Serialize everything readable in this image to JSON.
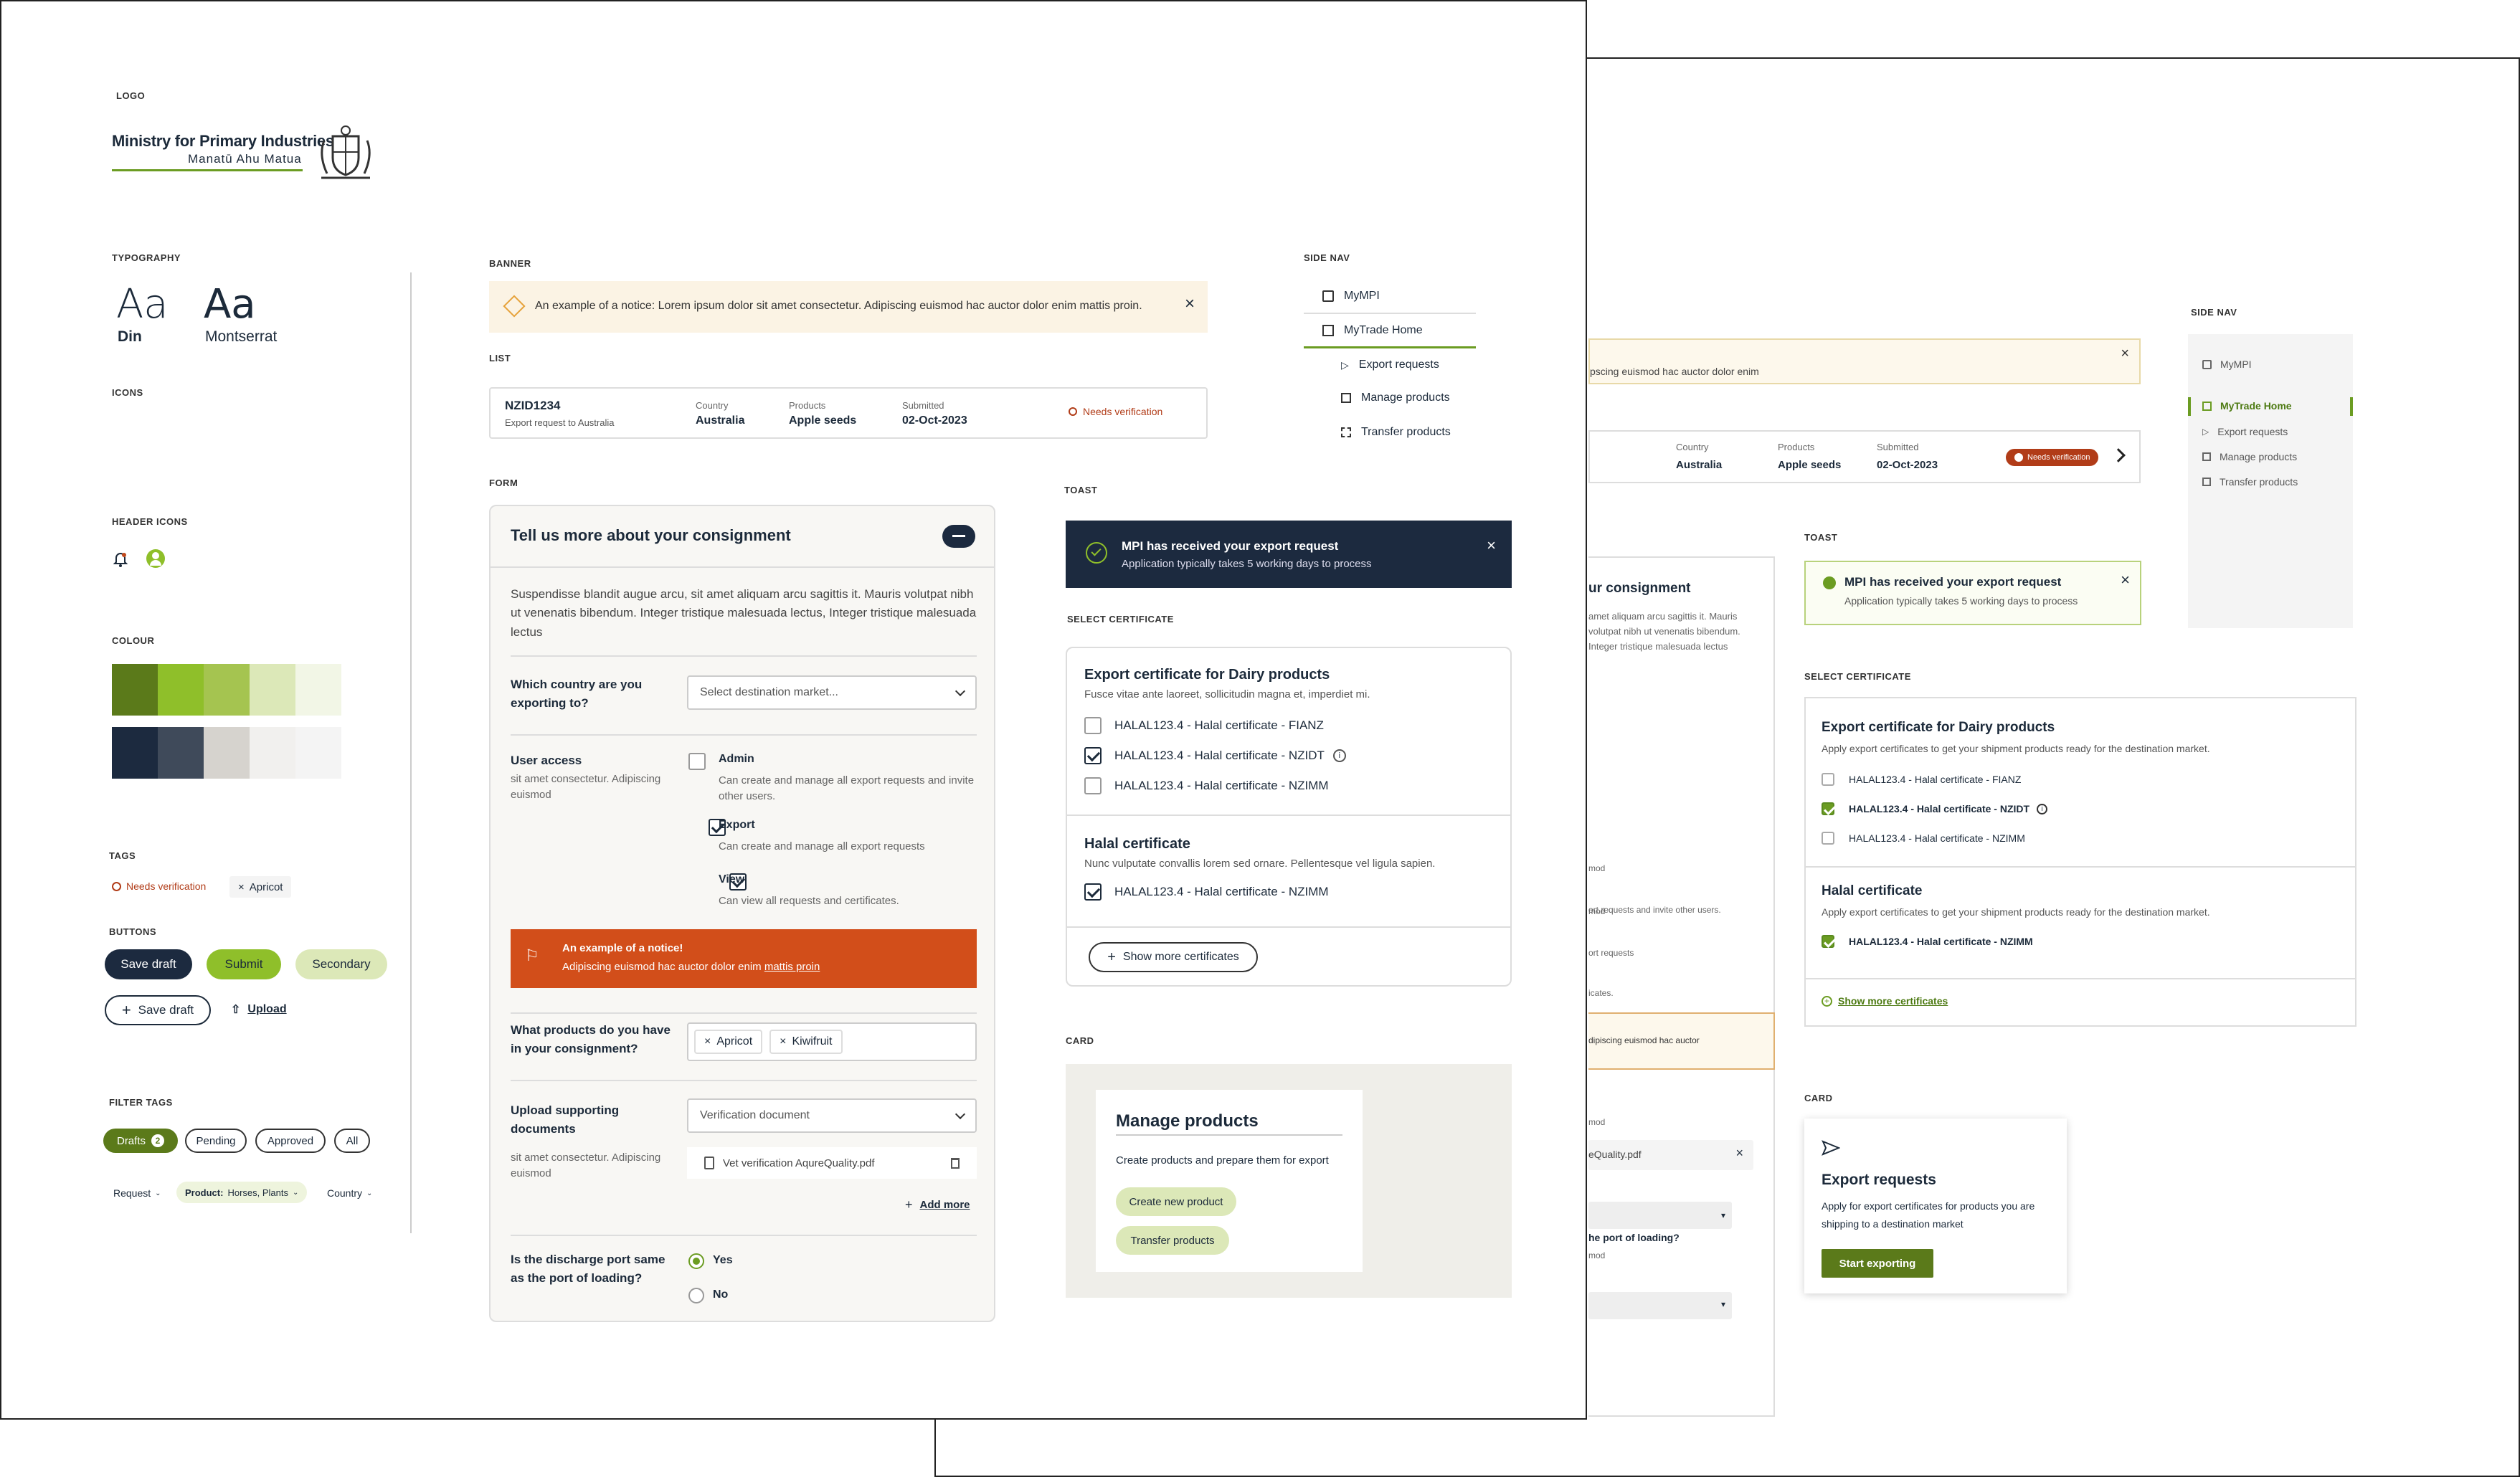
{
  "left": {
    "logo_label": "LOGO",
    "logo_title": "Ministry for Primary Industries",
    "logo_subtitle": "Manatū Ahu Matua",
    "typography_label": "TYPOGRAPHY",
    "type_sample": "Aa",
    "font_din": "Din",
    "font_montserrat": "Montserrat",
    "icons_label": "ICONS",
    "header_icons_label": "HEADER ICONS",
    "colour_label": "COLOUR",
    "colours_row1": [
      "#5b7a1a",
      "#8fbf2a",
      "#a5c450",
      "#dce8b8",
      "#f2f6e6"
    ],
    "colours_row2": [
      "#1c2a3f",
      "#3f4a5a",
      "#d6d3ce",
      "#f1f0ee",
      "#f4f4f4"
    ],
    "tags_label": "TAGS",
    "tag_needs": "Needs verification",
    "tag_apricot": "Apricot",
    "buttons_label": "BUTTONS",
    "btn_save_draft": "Save draft",
    "btn_submit": "Submit",
    "btn_secondary": "Secondary",
    "btn_save_draft_outline": "Save draft",
    "btn_upload": "Upload",
    "filter_label": "FILTER TAGS",
    "filter_drafts": "Drafts",
    "filter_drafts_count": "2",
    "filter_pending": "Pending",
    "filter_approved": "Approved",
    "filter_all": "All",
    "dd_request": "Request",
    "dd_product_key": "Product:",
    "dd_product_value": "Horses, Plants",
    "dd_country": "Country"
  },
  "banner": {
    "label": "BANNER",
    "text": "An example of a notice: Lorem ipsum dolor sit amet consectetur. Adipiscing euismod hac auctor dolor enim mattis proin."
  },
  "list": {
    "label": "LIST",
    "id": "NZID1234",
    "desc": "Export request to Australia",
    "country_label": "Country",
    "country": "Australia",
    "products_label": "Products",
    "products": "Apple seeds",
    "submitted_label": "Submitted",
    "submitted": "02-Oct-2023",
    "status": "Needs verification"
  },
  "sidenav": {
    "label": "SIDE NAV",
    "items": [
      "MyMPI",
      "MyTrade Home",
      "Export requests",
      "Manage products",
      "Transfer products"
    ]
  },
  "form": {
    "label": "FORM",
    "title": "Tell us more about your consignment",
    "intro": "Suspendisse blandit augue arcu, sit amet aliquam arcu sagittis it. Mauris volutpat nibh ut venenatis bibendum. Integer tristique malesuada lectus, Integer tristique malesuada lectus",
    "q_country": "Which country are you exporting to?",
    "country_placeholder": "Select destination market...",
    "q_user_access": "User access",
    "user_access_hint": "sit amet consectetur. Adipiscing euismod",
    "opt_admin": "Admin",
    "opt_admin_desc": "Can create and manage all export requests and invite other users.",
    "opt_export": "Export",
    "opt_export_desc": "Can create and manage all export requests",
    "opt_view": "View",
    "opt_view_desc": "Can view all requests and certificates.",
    "notice_title": "An example of a notice!",
    "notice_text": "Adipiscing euismod hac auctor dolor enim ",
    "notice_link": "mattis proin",
    "q_products": "What products do you have in your consignment?",
    "product_tags": [
      "Apricot",
      "Kiwifruit"
    ],
    "q_upload": "Upload supporting documents",
    "upload_hint": "sit amet consectetur. Adipiscing euismod",
    "upload_select": "Verification document",
    "file_name": "Vet verification AqureQuality.pdf",
    "add_more": "Add more",
    "q_discharge": "Is the discharge port same as the port of loading?",
    "radio_yes": "Yes",
    "radio_no": "No"
  },
  "toast": {
    "label": "TOAST",
    "title": "MPI has received your export request",
    "text": "Application typically takes 5 working days to process"
  },
  "certificate": {
    "label": "SELECT CERTIFICATE",
    "group1_title": "Export certificate for Dairy products",
    "group1_desc": "Fusce vitae ante laoreet, sollicitudin magna et, imperdiet mi.",
    "items": [
      "HALAL123.4 - Halal certificate - FIANZ",
      "HALAL123.4 - Halal certificate - NZIDT",
      "HALAL123.4 - Halal certificate - NZIMM"
    ],
    "group2_title": "Halal certificate",
    "group2_desc": "Nunc vulputate convallis lorem sed ornare. Pellentesque vel ligula sapien.",
    "group2_item": "HALAL123.4 - Halal certificate - NZIMM",
    "show_more": "Show more certificates"
  },
  "card": {
    "label": "CARD",
    "title": "Manage products",
    "text": "Create products and prepare them for export",
    "btn_create": "Create new product",
    "btn_transfer": "Transfer products"
  },
  "back": {
    "banner_text": "pscing euismod hac auctor dolor enim",
    "country_label": "Country",
    "country": "Australia",
    "products_label": "Products",
    "products": "Apple seeds",
    "submitted_label": "Submitted",
    "submitted": "02-Oct-2023",
    "status": "Needs verification",
    "toast_label": "TOAST",
    "toast_title": "MPI has received your export request",
    "toast_text": "Application typically takes 5 working days to process",
    "cert_label": "SELECT CERTIFICATE",
    "g1_title": "Export certificate for Dairy products",
    "g1_desc": "Apply export certificates to get your shipment products ready for the destination market.",
    "items": [
      "HALAL123.4 - Halal certificate - FIANZ",
      "HALAL123.4 - Halal certificate - NZIDT",
      "HALAL123.4 - Halal certificate - NZIMM"
    ],
    "g2_title": "Halal certificate",
    "g2_desc": "Apply export certificates to get your shipment products ready for the destination market.",
    "g2_item": "HALAL123.4 - Halal certificate - NZIMM",
    "show_more": "Show more certificates",
    "card_label": "CARD",
    "card_title": "Export requests",
    "card_text": "Apply for export certificates for products you are shipping to a destination market",
    "card_btn": "Start exporting",
    "sidenav_label": "SIDE NAV",
    "nav": [
      "MyMPI",
      "MyTrade Home",
      "Export requests",
      "Manage products",
      "Transfer products"
    ],
    "form_title": "ur consignment",
    "form_intro": "amet aliquam arcu sagittis it. Mauris volutpat nibh ut venenatis bibendum. Integer tristique malesuada lectus",
    "frag1": "mod",
    "frag2": "ort requests and invite other users.",
    "frag3": "ort requests",
    "frag4": "icates.",
    "frag5": "dipiscing euismod hac auctor",
    "frag6": "mod",
    "frag7": "eQuality.pdf",
    "frag8": "he port of loading?",
    "frag9": "mod"
  }
}
